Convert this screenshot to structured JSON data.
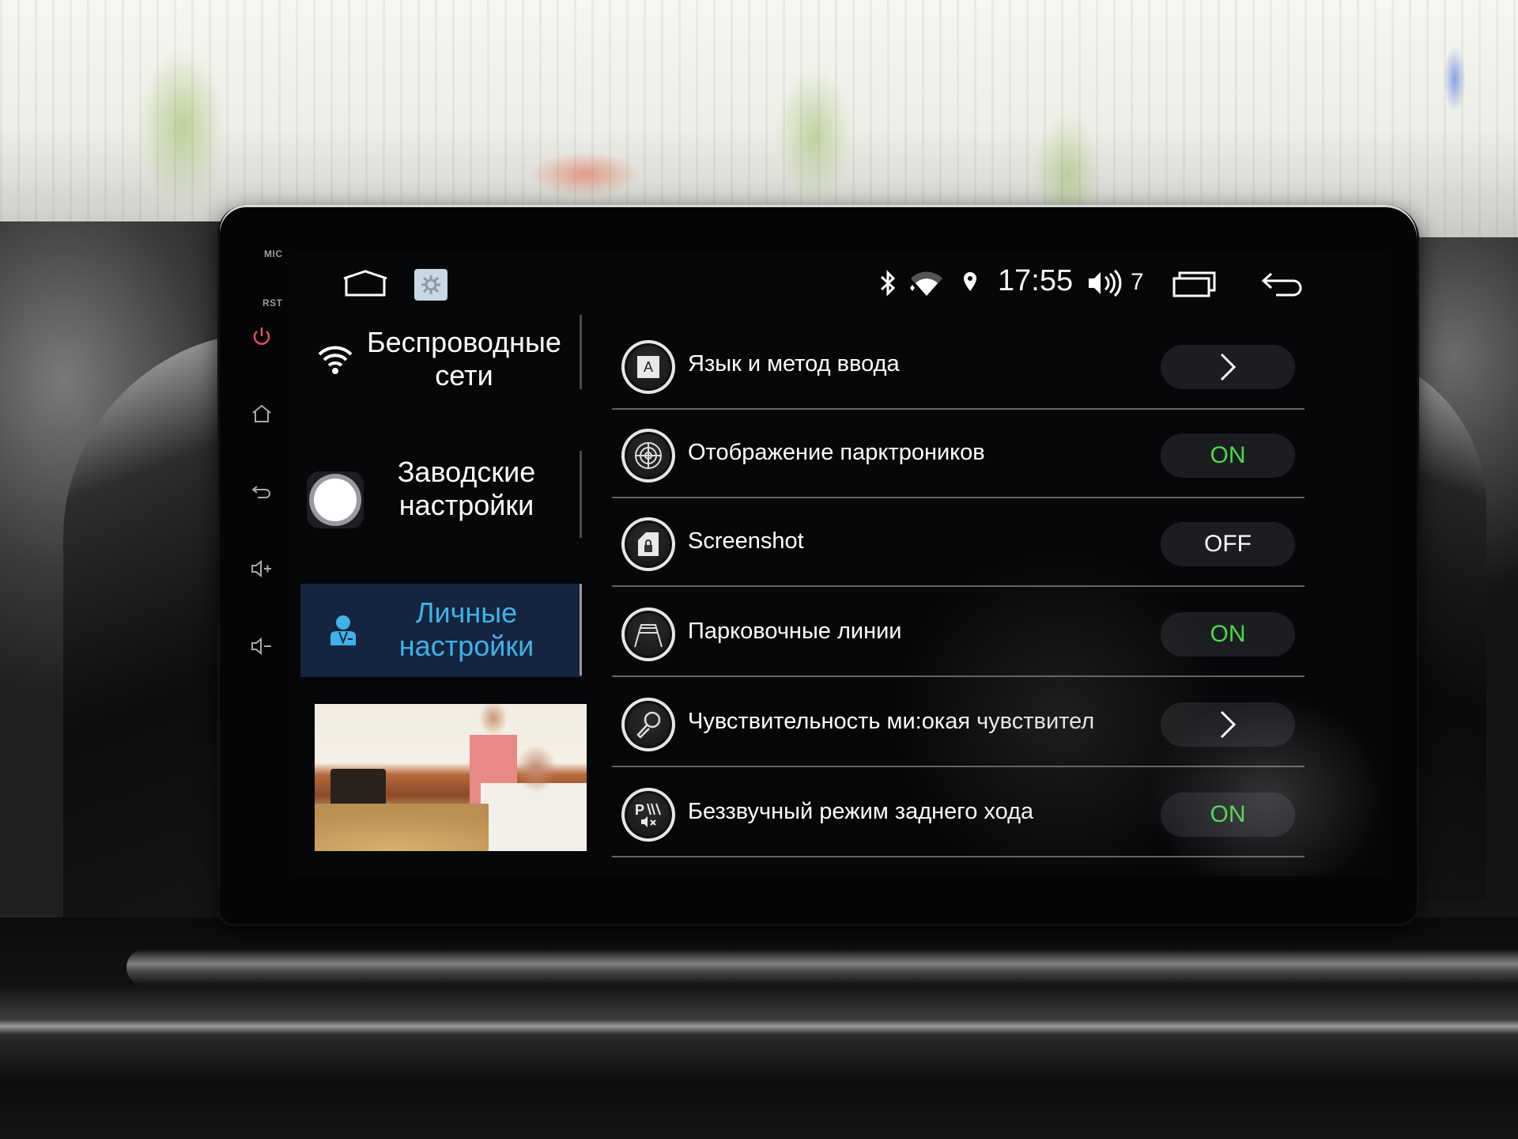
{
  "bezel": {
    "mic_label": "MIC",
    "rst_label": "RST",
    "buttons": [
      {
        "icon": "power-icon",
        "color": "#e0505a"
      },
      {
        "icon": "home-icon"
      },
      {
        "icon": "back-icon"
      },
      {
        "icon": "volume-up-icon"
      },
      {
        "icon": "volume-down-icon"
      }
    ]
  },
  "topbar": {
    "left_icons": [
      "home-outline-icon",
      "settings-app-icon"
    ],
    "status": {
      "bluetooth": "bluetooth-icon",
      "wifi": "wifi-signal-icon",
      "location": "location-pin-icon",
      "time": "17:55",
      "volume_icon": "speaker-icon",
      "volume_level": "7"
    },
    "right_icons": [
      "recent-apps-icon",
      "back-arrow-icon"
    ]
  },
  "sidebar": {
    "items": [
      {
        "id": "wireless",
        "icon": "wifi-icon",
        "line1": "Беспроводные",
        "line2": "сети",
        "active": false
      },
      {
        "id": "factory",
        "icon": "factory-settings-icon",
        "line1": "Заводские",
        "line2": "настройки",
        "active": false
      },
      {
        "id": "personal",
        "icon": "person-icon",
        "line1": "Личные",
        "line2": "настройки",
        "active": true
      }
    ],
    "active_color": "#3fb2e8",
    "video_preview": "video-thumbnail"
  },
  "settings": {
    "rows": [
      {
        "icon": "language-input-icon",
        "label": "Язык и метод ввода",
        "control": ">",
        "type": "chevron"
      },
      {
        "icon": "parking-sensor-radar-icon",
        "label": "Отображение парктроников",
        "control": "ON",
        "type": "toggle"
      },
      {
        "icon": "screenshot-door-lock-icon",
        "label": "Screenshot",
        "control": "OFF",
        "type": "toggle"
      },
      {
        "icon": "parking-lines-icon",
        "label": "Парковочные линии",
        "control": "ON",
        "type": "toggle"
      },
      {
        "icon": "microphone-icon",
        "label": "Чувствительность ми:окая чувствител",
        "control": ">",
        "type": "chevron"
      },
      {
        "icon": "reverse-mute-icon",
        "label": "Беззвучный режим заднего хода",
        "control": "ON",
        "type": "toggle"
      }
    ],
    "on_color": "#4cd94a",
    "off_color": "#ffffff"
  }
}
